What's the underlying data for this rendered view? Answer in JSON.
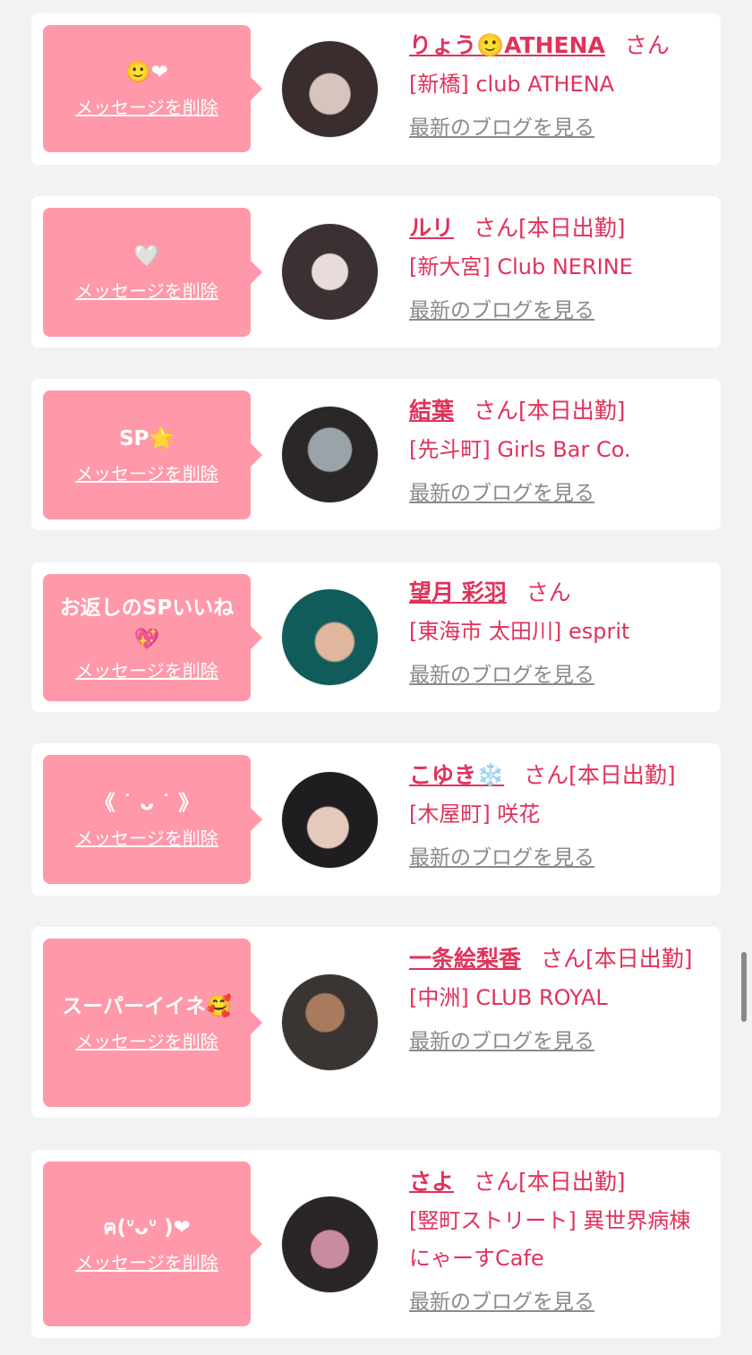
{
  "common": {
    "delete_label": "メッセージを削除",
    "blog_label": "最新のブログを見る",
    "san": "さん"
  },
  "messages": [
    {
      "bubble": "🙂❤",
      "name": "りょう🙂ATHENA",
      "status": "",
      "shop": "[新橋] club ATHENA",
      "avatar_colors": [
        "#3a2d2e",
        "#d8c4bf"
      ]
    },
    {
      "bubble": "🤍",
      "name": "ルリ",
      "status": "[本日出勤]",
      "shop": "[新大宮] Club NERINE",
      "avatar_colors": [
        "#3b3132",
        "#e7dcd9"
      ]
    },
    {
      "bubble": "SP🌟",
      "name": "結葉",
      "status": "[本日出勤]",
      "shop": "[先斗町] Girls Bar Co.",
      "avatar_colors": [
        "#2b2727",
        "#9aa4a8"
      ]
    },
    {
      "bubble": "お返しのSPいいね💖",
      "name": "望月 彩羽",
      "status": "",
      "shop": "[東海市 太田川] esprit",
      "avatar_colors": [
        "#0f5c5a",
        "#e0b79c"
      ]
    },
    {
      "bubble": "《 ˙ ᴗ ˙ 》",
      "name": "こゆき❄️",
      "status": "[本日出勤]",
      "shop": "[木屋町] 咲花",
      "avatar_colors": [
        "#1f1d1f",
        "#e6c9bd"
      ]
    },
    {
      "bubble": "スーパーイイネ🥰",
      "name": "一条絵梨香",
      "status": "[本日出勤]",
      "shop": "[中洲] CLUB ROYAL",
      "avatar_colors": [
        "#3a3533",
        "#a97a5e"
      ]
    },
    {
      "bubble": "ฅ(ᐡᴗᐡ )❤",
      "name": "さよ",
      "status": "[本日出勤]",
      "shop": "[竪町ストリート] 異世界病棟にゃーすCafe",
      "avatar_colors": [
        "#2a2527",
        "#c98c9e"
      ]
    }
  ]
}
